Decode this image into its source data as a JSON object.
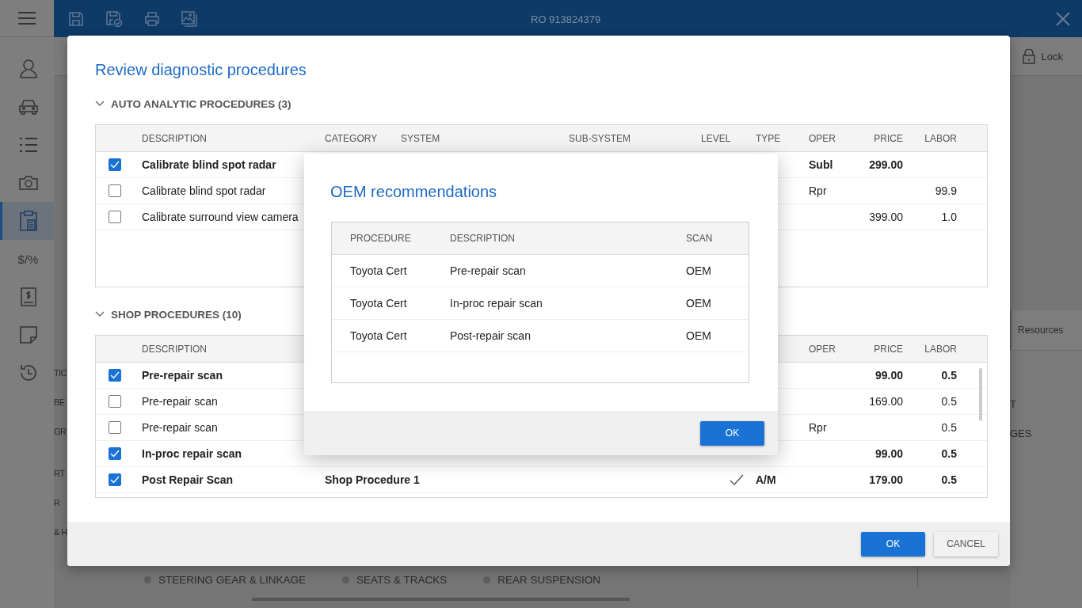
{
  "app": {
    "title": "RO 913824379"
  },
  "sidebar": {
    "items": [
      {
        "kind": "person",
        "selected": false
      },
      {
        "kind": "car",
        "selected": false
      },
      {
        "kind": "list",
        "selected": false
      },
      {
        "kind": "camera",
        "selected": false
      },
      {
        "kind": "clipboard",
        "selected": true
      },
      {
        "kind": "text",
        "label": "$/%",
        "selected": false
      },
      {
        "kind": "invoice",
        "selected": false
      },
      {
        "kind": "note",
        "selected": false
      },
      {
        "kind": "history",
        "selected": false
      }
    ]
  },
  "background": {
    "lock_label": "Lock",
    "resources_label": "Resources",
    "left_fragments": [
      [
        "TIC",
        "BE",
        "GR"
      ],
      [
        "RT",
        "R",
        "& H"
      ]
    ],
    "right_fragments": [
      "T",
      "GES"
    ],
    "bottom_tabs": [
      "STEERING GEAR & LINKAGE",
      "SEATS & TRACKS",
      "REAR SUSPENSION"
    ]
  },
  "dialog": {
    "title": "Review diagnostic procedures",
    "sections": [
      {
        "heading": "AUTO ANALYTIC PROCEDURES (3)",
        "expanded": true,
        "scrollable": false,
        "columns": {
          "desc": "DESCRIPTION",
          "category": "CATEGORY",
          "system": "SYSTEM",
          "subsystem": "SUB-SYSTEM",
          "level": "LEVEL",
          "type": "TYPE",
          "oper": "OPER",
          "price": "PRICE",
          "labor": "LABOR"
        },
        "rows": [
          {
            "checked": true,
            "desc": "Calibrate blind spot radar",
            "oper": "Subl",
            "price": "299.00"
          },
          {
            "checked": false,
            "desc": "Calibrate blind spot radar",
            "oper": "Rpr",
            "labor": "99.9"
          },
          {
            "checked": false,
            "desc": "Calibrate surround view camera",
            "price": "399.00",
            "labor": "1.0"
          }
        ]
      },
      {
        "heading": "SHOP PROCEDURES (10)",
        "expanded": true,
        "scrollable": true,
        "columns": {
          "desc": "DESCRIPTION",
          "oper": "OPER",
          "price": "PRICE",
          "labor": "LABOR"
        },
        "rows": [
          {
            "checked": true,
            "desc": "Pre-repair scan",
            "price": "99.00",
            "labor": "0.5"
          },
          {
            "checked": false,
            "desc": "Pre-repair scan",
            "price": "169.00",
            "labor": "0.5"
          },
          {
            "checked": false,
            "desc": "Pre-repair scan",
            "oper": "Rpr",
            "labor": "0.5"
          },
          {
            "checked": true,
            "desc": "In-proc repair scan",
            "price": "99.00",
            "labor": "0.5"
          },
          {
            "checked": true,
            "desc": "Post Repair Scan",
            "category": "Shop Procedure 1",
            "level_check": true,
            "type": "A/M",
            "price": "179.00",
            "labor": "0.5"
          }
        ]
      }
    ],
    "buttons": [
      {
        "label": "OK",
        "kind": "primary"
      },
      {
        "label": "CANCEL",
        "kind": "secondary"
      }
    ]
  },
  "oem_dialog": {
    "title": "OEM recommendations",
    "columns": [
      "PROCEDURE",
      "DESCRIPTION",
      "SCAN"
    ],
    "rows": [
      [
        "Toyota Cert",
        "Pre-repair scan",
        "OEM"
      ],
      [
        "Toyota Cert",
        "In-proc repair scan",
        "OEM"
      ],
      [
        "Toyota Cert",
        "Post-repair scan",
        "OEM"
      ]
    ],
    "button": "OK"
  }
}
